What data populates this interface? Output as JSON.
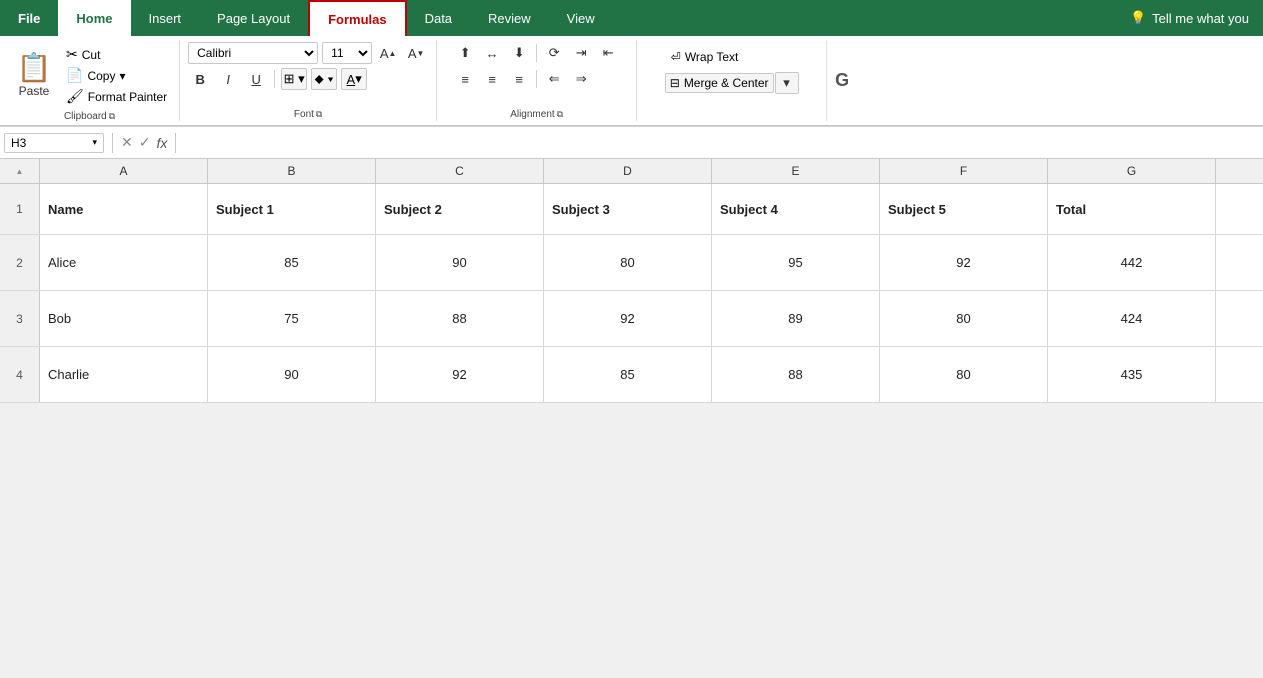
{
  "tabs": [
    {
      "id": "file",
      "label": "File",
      "type": "file"
    },
    {
      "id": "home",
      "label": "Home",
      "type": "active"
    },
    {
      "id": "insert",
      "label": "Insert",
      "type": "normal"
    },
    {
      "id": "page-layout",
      "label": "Page Layout",
      "type": "normal"
    },
    {
      "id": "formulas",
      "label": "Formulas",
      "type": "formulas"
    },
    {
      "id": "data",
      "label": "Data",
      "type": "normal"
    },
    {
      "id": "review",
      "label": "Review",
      "type": "normal"
    },
    {
      "id": "view",
      "label": "View",
      "type": "normal"
    }
  ],
  "tell_me": "Tell me what you",
  "ribbon": {
    "clipboard": {
      "label": "Clipboard",
      "paste_label": "Paste",
      "cut_label": "Cut",
      "copy_label": "Copy",
      "copy_dropdown": "▾",
      "format_painter_label": "Format Painter"
    },
    "font": {
      "label": "Font",
      "font_name": "Calibri",
      "font_size": "11",
      "bold": "B",
      "italic": "I",
      "underline": "U",
      "borders_icon": "⊞",
      "fill_icon": "⬥",
      "font_color_icon": "A"
    },
    "alignment": {
      "label": "Alignment"
    },
    "wrap_merge": {
      "wrap_text": "Wrap Text",
      "merge_center": "Merge & Center",
      "merge_dropdown": "▾"
    }
  },
  "formula_bar": {
    "cell_ref": "H3",
    "dropdown_icon": "▾",
    "cancel_icon": "✕",
    "confirm_icon": "✓",
    "function_icon": "fx"
  },
  "spreadsheet": {
    "col_headers": [
      "A",
      "B",
      "C",
      "D",
      "E",
      "F",
      "G"
    ],
    "rows": [
      {
        "row_num": "1",
        "cells": [
          "Name",
          "Subject 1",
          "Subject 2",
          "Subject 3",
          "Subject 4",
          "Subject 5",
          "Total"
        ],
        "is_header": true
      },
      {
        "row_num": "2",
        "cells": [
          "Alice",
          "85",
          "90",
          "80",
          "95",
          "92",
          "442"
        ],
        "is_header": false
      },
      {
        "row_num": "3",
        "cells": [
          "Bob",
          "75",
          "88",
          "92",
          "89",
          "80",
          "424"
        ],
        "is_header": false
      },
      {
        "row_num": "4",
        "cells": [
          "Charlie",
          "90",
          "92",
          "85",
          "88",
          "80",
          "435"
        ],
        "is_header": false
      }
    ]
  }
}
